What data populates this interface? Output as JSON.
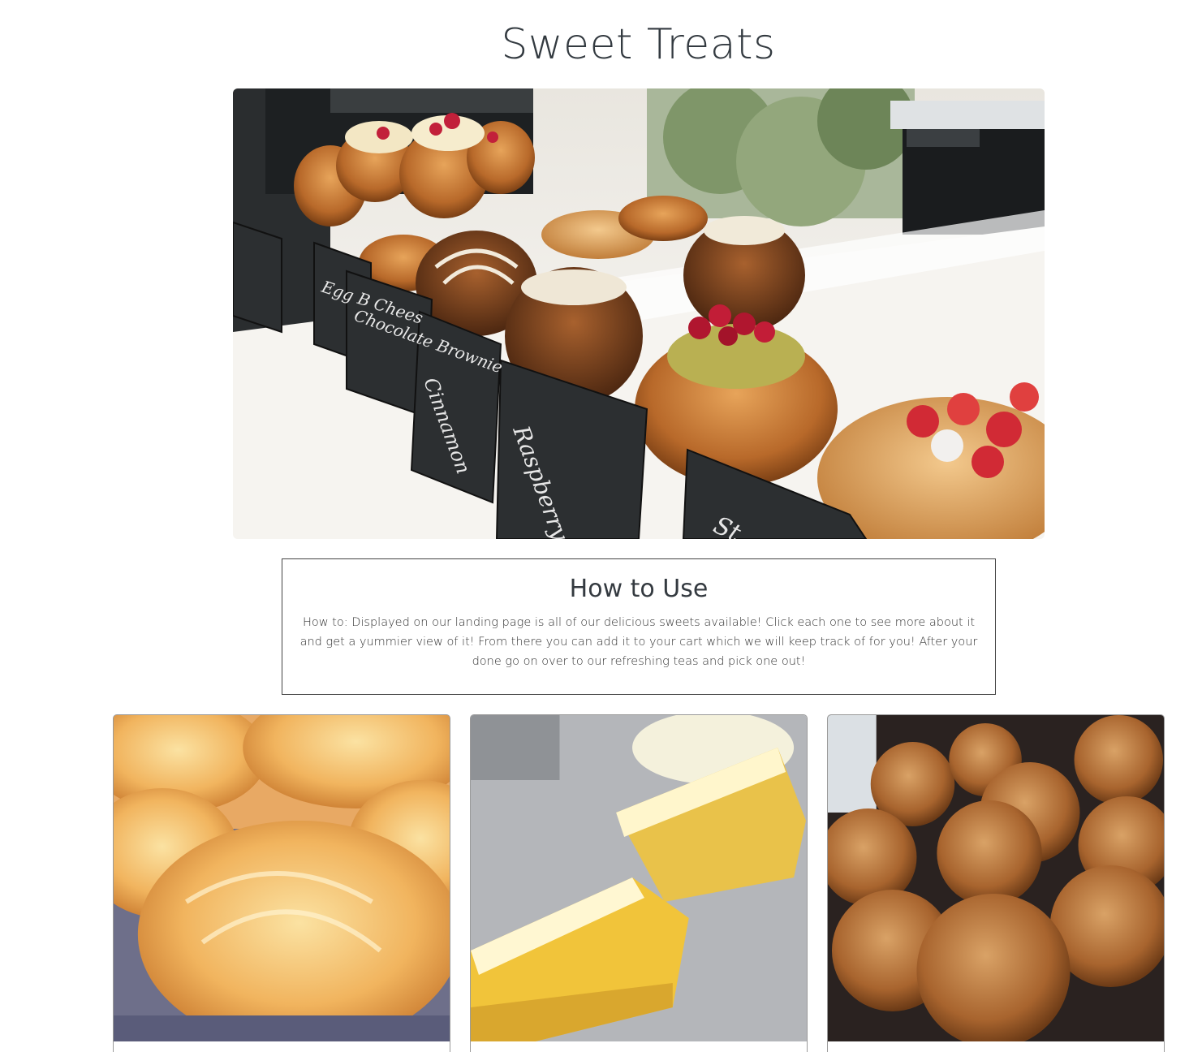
{
  "header": {
    "title": "Sweet Treats"
  },
  "hero": {
    "image_icon": "pastry-display-photo",
    "chalkboard_labels": [
      "Egg B Chees",
      "Chocolate Brownie",
      "Cinnamon",
      "Raspberry Pistac",
      "St"
    ]
  },
  "how_to": {
    "heading": "How to Use",
    "body": "How to: Displayed on our landing page is all of our delicious sweets available! Click each one to see more about it and get a yummier view of it! From there you can add it to your cart which we will keep track of for you! After your done go on over to our refreshing teas and pick one out!"
  },
  "products": [
    {
      "image_icon": "kouign-amann-photo"
    },
    {
      "image_icon": "lemon-bar-photo"
    },
    {
      "image_icon": "muffin-photo"
    }
  ]
}
